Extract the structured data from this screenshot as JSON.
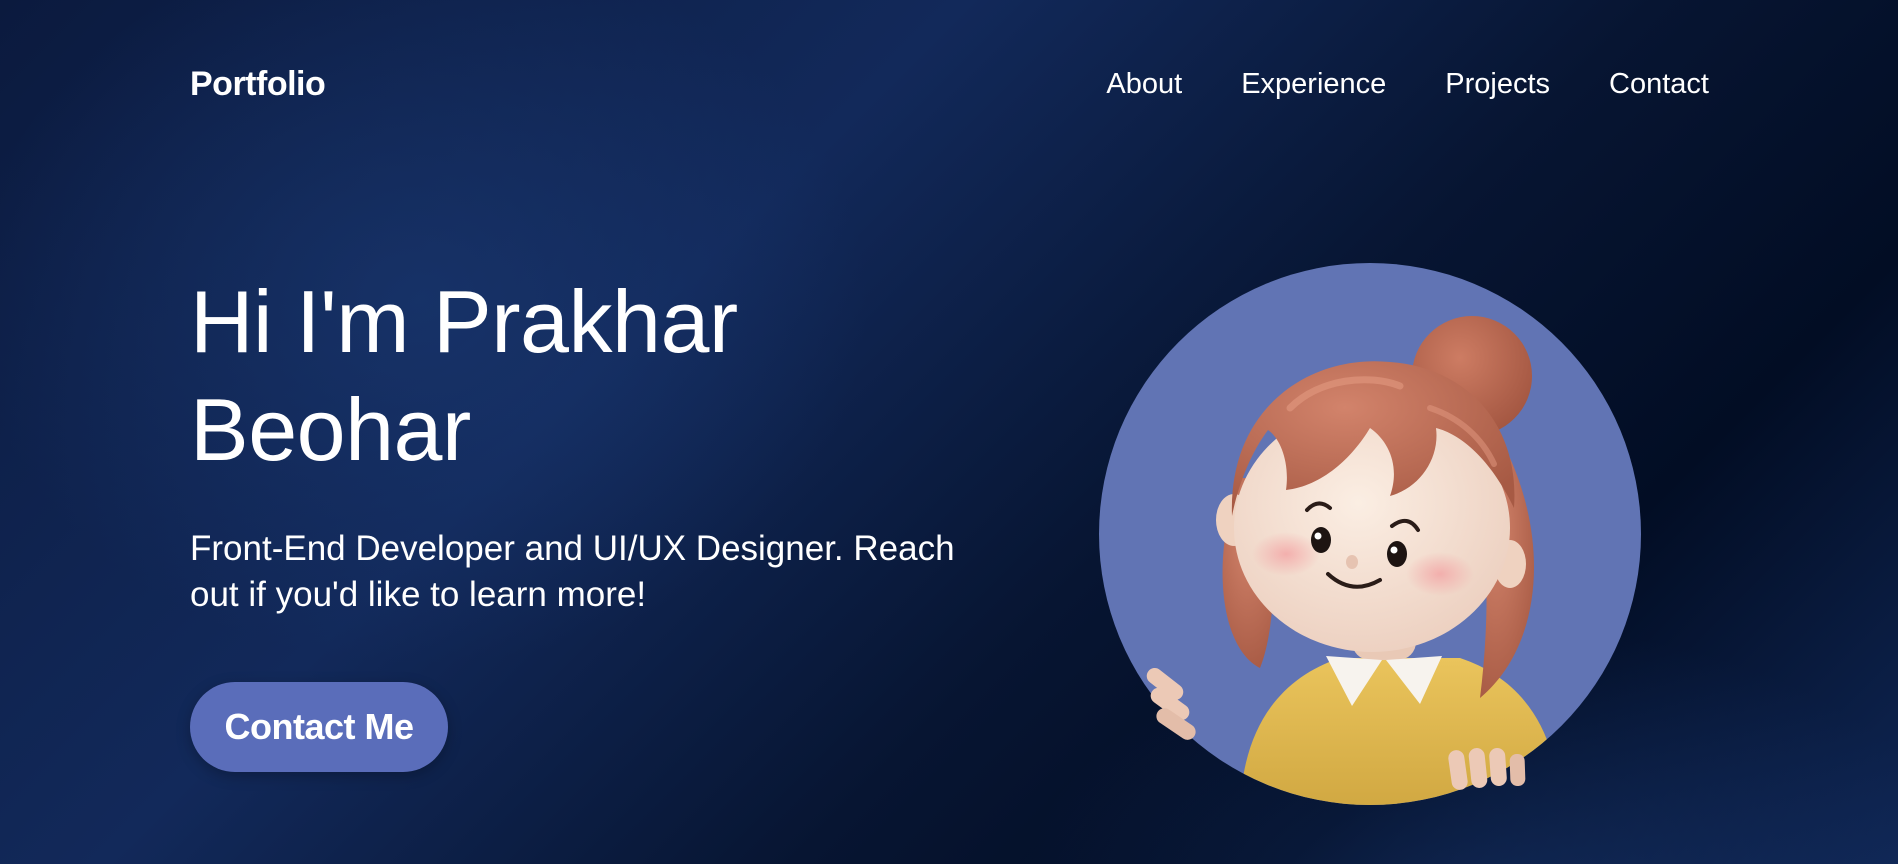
{
  "nav": {
    "brand": "Portfolio",
    "links": [
      "About",
      "Experience",
      "Projects",
      "Contact"
    ]
  },
  "hero": {
    "title_line1": "Hi I'm Prakhar",
    "title_line2": "Beohar",
    "subtitle_line1": "Front-End Developer and UI/UX Designer. Reach",
    "subtitle_line2": "out if you'd like to learn more!",
    "cta_label": "Contact Me"
  },
  "avatar": {
    "icon": "cartoon-girl-avatar",
    "circle_color": "#6174b4",
    "hair_color": "#b96a52",
    "shirt_color": "#e2b94f"
  },
  "colors": {
    "background": "#0b1a3e",
    "accent": "#5a6dba",
    "text": "#ffffff"
  }
}
